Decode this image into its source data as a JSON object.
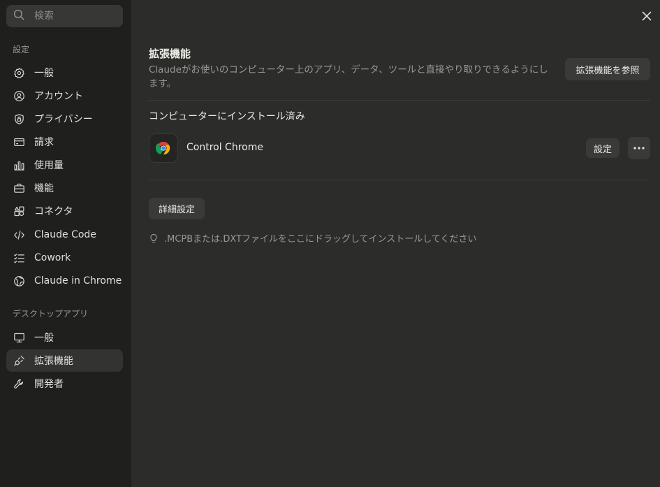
{
  "search": {
    "placeholder": "検索"
  },
  "sidebar": {
    "settings_label": "設定",
    "settings_items": [
      {
        "label": "一般",
        "icon": "gear-icon"
      },
      {
        "label": "アカウント",
        "icon": "user-circle-icon"
      },
      {
        "label": "プライバシー",
        "icon": "shield-lock-icon"
      },
      {
        "label": "請求",
        "icon": "credit-card-icon"
      },
      {
        "label": "使用量",
        "icon": "bar-chart-icon"
      },
      {
        "label": "機能",
        "icon": "briefcase-icon"
      },
      {
        "label": "コネクタ",
        "icon": "shapes-icon"
      },
      {
        "label": "Claude Code",
        "icon": "code-icon"
      },
      {
        "label": "Cowork",
        "icon": "list-check-icon"
      },
      {
        "label": "Claude in Chrome",
        "icon": "globe-icon"
      }
    ],
    "desktop_label": "デスクトップアプリ",
    "desktop_items": [
      {
        "label": "一般",
        "icon": "monitor-icon"
      },
      {
        "label": "拡張機能",
        "icon": "plug-icon",
        "active": true
      },
      {
        "label": "開発者",
        "icon": "wrench-icon"
      }
    ]
  },
  "main": {
    "title": "拡張機能",
    "description": "Claudeがお使いのコンピューター上のアプリ、データ、ツールと直接やり取りできるようにします。",
    "browse_button": "拡張機能を参照",
    "installed_title": "コンピューターにインストール済み",
    "extensions": [
      {
        "name": "Control Chrome",
        "icon": "chrome-logo-icon",
        "settings_button": "設定"
      }
    ],
    "advanced_button": "詳細設定",
    "drag_hint": ".MCPBまたは.DXTファイルをここにドラッグしてインストールしてください"
  },
  "colors": {
    "sidebar_bg": "#1f1f1e",
    "content_bg": "#2c2c2a",
    "button_bg": "#3a3a38",
    "active_item_bg": "#333331"
  }
}
